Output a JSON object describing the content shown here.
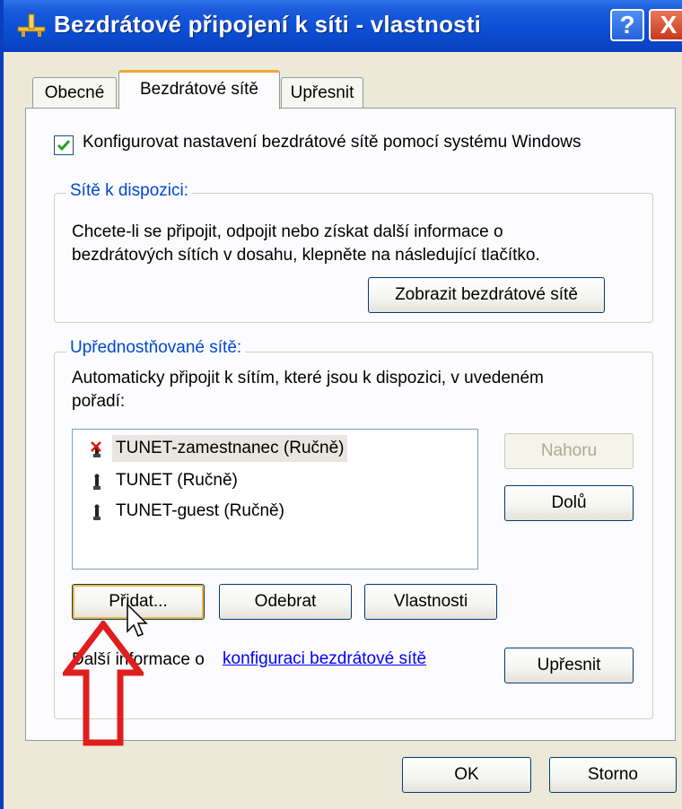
{
  "window": {
    "title": "Bezdrátové připojení k síti - vlastnosti",
    "help_label": "?",
    "close_label": "X"
  },
  "tabs": [
    {
      "label": "Obecné",
      "selected": false
    },
    {
      "label": "Bezdrátové sítě",
      "selected": true
    },
    {
      "label": "Upřesnit",
      "selected": false
    }
  ],
  "config_checkbox": {
    "label": "Konfigurovat nastavení bezdrátové sítě pomocí systému Windows",
    "checked": true
  },
  "available_networks": {
    "legend": "Sítě k dispozici:",
    "line1": "Chcete-li se připojit, odpojit nebo získat další informace o",
    "line2": "bezdrátových sítích v dosahu, klepněte na následující tlačítko.",
    "view_button": "Zobrazit bezdrátové sítě"
  },
  "preferred_networks": {
    "legend": "Upřednostňované sítě:",
    "line1": "Automaticky připojit k sítím, které jsou k dispozici, v uvedeném",
    "line2": "pořadí:",
    "items": [
      {
        "label": "TUNET-zamestnanec (Ručně)",
        "icon": "antenna-error-icon",
        "selected": true
      },
      {
        "label": "TUNET (Ručně)",
        "icon": "antenna-icon",
        "selected": false
      },
      {
        "label": "TUNET-guest (Ručně)",
        "icon": "antenna-icon",
        "selected": false
      }
    ],
    "up_button": "Nahoru",
    "down_button": "Dolů",
    "add_button": "Přidat...",
    "remove_button": "Odebrat",
    "properties_button": "Vlastnosti",
    "info_text": "Další informace o",
    "info_link": "konfiguraci bezdrátové sítě",
    "advanced_button": "Upřesnit"
  },
  "footer": {
    "ok_button": "OK",
    "cancel_button": "Storno"
  },
  "colors": {
    "title_bar": "#0c4fd6",
    "legend_text": "#0046d5",
    "link": "#0000ff",
    "annotation_arrow": "#e01e1e"
  }
}
